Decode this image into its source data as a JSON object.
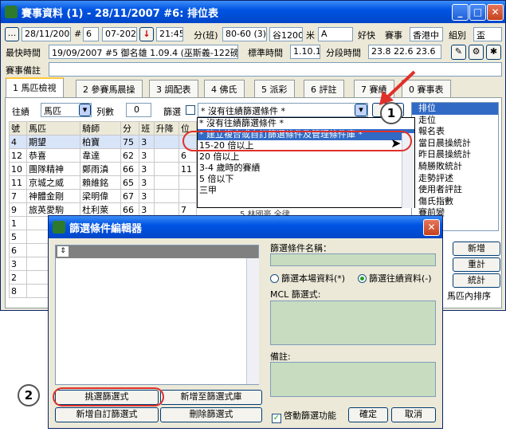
{
  "main_window": {
    "title": "賽事資料 (1) - 28/11/2007 #6: 排位表",
    "row1": {
      "ellipsis": "...",
      "date": "28/11/2007",
      "hash": "#",
      "race_no": "6",
      "race_code": "07-202",
      "time": "21:45",
      "class_label": "分(班)",
      "class_value": "80-60 (3)",
      "venue_dist": "谷1200",
      "meter_label": "米",
      "course": "A",
      "going": "好快",
      "event_label": "賽事",
      "track": "香港中",
      "group_label": "組別",
      "group_value": "盃"
    },
    "row2": {
      "fastest_label": "最快時間",
      "fastest_value": "19/09/2007 #5 御名雄 1.09.4 (巫斯義-122磅)",
      "std_label": "標準時間",
      "std_value": "1.10.1",
      "split_label": "分段時間",
      "split_value": "23.8  22.6  23.6"
    },
    "remark_label": "賽事備註",
    "tabs": [
      "1 馬匹檢視",
      "2 參賽馬晨操",
      "3 調配表",
      "4 佛氏",
      "5 派彩",
      "6 評註",
      "7 賽績",
      "0 賽事表"
    ],
    "filter_bar": {
      "record_label": "往績",
      "record_select": "馬匹",
      "cols_label": "列數",
      "cols_value": "0",
      "filter_label": "篩選",
      "filter_select": "* 沒有往績篩選條件 *",
      "apply_btn": "篩"
    },
    "dropdown": {
      "items": [
        "* 沒有往績篩選條件 *",
        "* 建立複合或自訂篩選條件及管理條件庫 *",
        "15-20 倍以上",
        "20 倍以上",
        "3-4 歲時的賽績",
        "5 倍以下",
        "三甲"
      ],
      "selected": 1
    },
    "grid": {
      "headers": [
        "號",
        "馬匹",
        "騎師",
        "分",
        "班",
        "升降",
        "位"
      ],
      "rows": [
        [
          "4",
          "期望",
          "柏寶",
          "75",
          "3",
          "",
          ""
        ],
        [
          "12",
          "恭喜",
          "韋達",
          "62",
          "3",
          "",
          "6"
        ],
        [
          "10",
          "團隊精神",
          "鄭雨滇",
          "66",
          "3",
          "",
          "11"
        ],
        [
          "11",
          "京城之威",
          "賴維銘",
          "65",
          "3",
          "",
          ""
        ],
        [
          "7",
          "神體金剛",
          "梁明偉",
          "67",
          "3",
          "",
          ""
        ],
        [
          "9",
          "旅英愛駒",
          "杜利萊",
          "66",
          "3",
          "",
          "7"
        ],
        [
          "1",
          "",
          "",
          "",
          "",
          "",
          ""
        ],
        [
          "5",
          "",
          "",
          "",
          "",
          "",
          ""
        ],
        [
          "6",
          "",
          "",
          "",
          "",
          "",
          ""
        ],
        [
          "3",
          "",
          "",
          "",
          "",
          "",
          ""
        ],
        [
          "2",
          "",
          "",
          "",
          "",
          "",
          ""
        ],
        [
          "8",
          "",
          "",
          "",
          "",
          "",
          ""
        ]
      ],
      "partial_cell": "5 林國豪 全律"
    },
    "right_list": {
      "items": [
        "排位",
        "走位",
        "報名表",
        "當日晨操統計",
        "昨日晨操統計",
        "騎勝敗統計",
        "走勢評述",
        "使用者評註",
        "傷氏指數",
        "賽前變"
      ],
      "selected": 0
    },
    "right_buttons": [
      "新增",
      "重計",
      "統計"
    ],
    "bottom_right_label": "馬匹內排序"
  },
  "dialog": {
    "title": "篩選條件編輯器",
    "name_label": "篩選條件名稱：",
    "name_value": "",
    "radio_local": "篩選本場資料(*)",
    "radio_record": "篩選往績資料(-)",
    "radio_selected": "record",
    "mcl_label": "MCL 篩選式:",
    "remark_label": "備註:",
    "btn_pick": "挑選篩選式",
    "btn_add_lib": "新增至篩選式庫",
    "btn_new_custom": "新增自訂篩選式",
    "btn_delete": "刪除篩選式",
    "enable_label": "啓動篩選功能",
    "enable_checked": true,
    "btn_ok": "確定",
    "btn_cancel": "取消"
  },
  "callouts": [
    "1",
    "2"
  ],
  "colors": {
    "title_blue": "#0054e3",
    "highlight_red": "#e0302a",
    "selection_blue": "#316ac5",
    "dialog_field_green": "#c8dcc0"
  }
}
